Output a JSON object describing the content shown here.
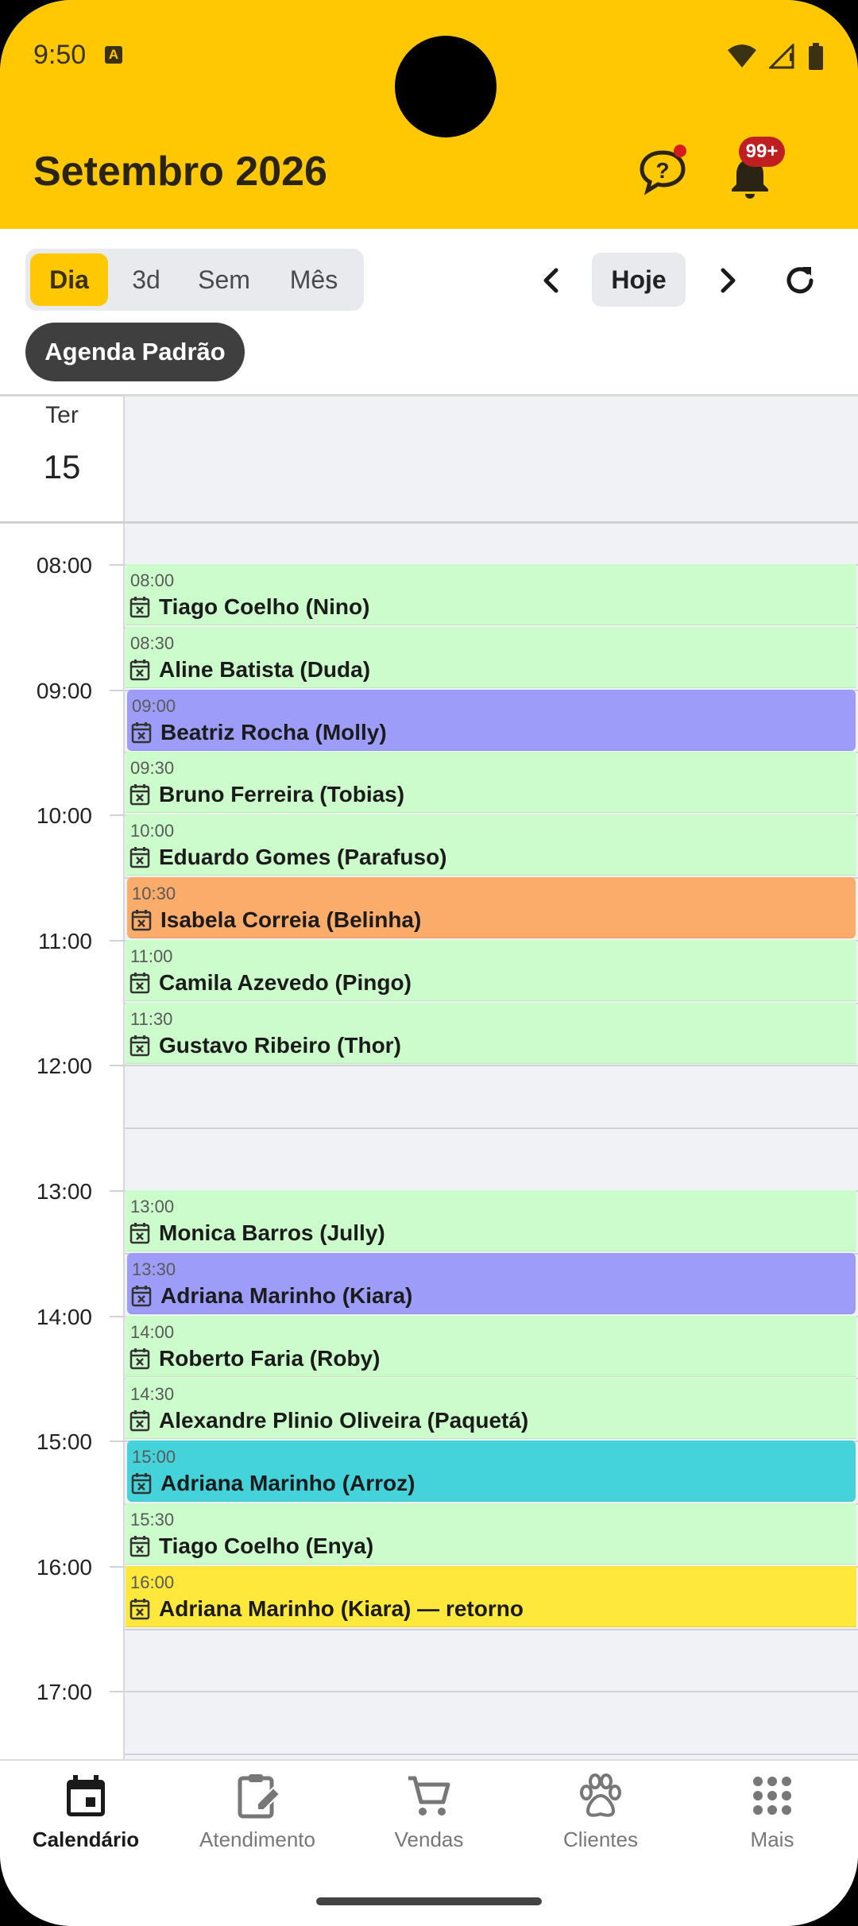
{
  "status": {
    "time": "9:50",
    "badge_letter": "A"
  },
  "header": {
    "title": "Setembro 2026",
    "notifications_badge": "99+"
  },
  "view_modes": [
    {
      "label": "Dia",
      "active": true
    },
    {
      "label": "3d",
      "active": false
    },
    {
      "label": "Sem",
      "active": false
    },
    {
      "label": "Mês",
      "active": false
    }
  ],
  "toolbar": {
    "today_label": "Hoje",
    "agenda_chip": "Agenda Padrão"
  },
  "day": {
    "weekday": "Ter",
    "number": "15"
  },
  "hours": [
    "08:00",
    "09:00",
    "10:00",
    "11:00",
    "12:00",
    "13:00",
    "14:00",
    "15:00",
    "16:00",
    "17:00"
  ],
  "events": [
    {
      "time": "08:00",
      "title": "Tiago Coelho (Nino)",
      "color": "#CCFCCB"
    },
    {
      "time": "08:30",
      "title": "Aline Batista (Duda)",
      "color": "#CCFCCB"
    },
    {
      "time": "09:00",
      "title": "Beatriz Rocha (Molly)",
      "color": "#9D9DF9"
    },
    {
      "time": "09:30",
      "title": "Bruno Ferreira (Tobias)",
      "color": "#CCFCCB"
    },
    {
      "time": "10:00",
      "title": "Eduardo Gomes (Parafuso)",
      "color": "#CCFCCB"
    },
    {
      "time": "10:30",
      "title": "Isabela Correia (Belinha)",
      "color": "#FBAB6A"
    },
    {
      "time": "11:00",
      "title": "Camila Azevedo (Pingo)",
      "color": "#CCFCCB"
    },
    {
      "time": "11:30",
      "title": "Gustavo Ribeiro (Thor)",
      "color": "#CCFCCB"
    },
    {
      "time": "13:00",
      "title": "Monica Barros (Jully)",
      "color": "#CCFCCB"
    },
    {
      "time": "13:30",
      "title": "Adriana Marinho (Kiara)",
      "color": "#9D9DF9"
    },
    {
      "time": "14:00",
      "title": "Roberto Faria (Roby)",
      "color": "#CCFCCB"
    },
    {
      "time": "14:30",
      "title": "Alexandre Plinio Oliveira (Paquetá)",
      "color": "#CCFCCB"
    },
    {
      "time": "15:00",
      "title": "Adriana Marinho (Arroz)",
      "color": "#44D3DB"
    },
    {
      "time": "15:30",
      "title": "Tiago Coelho (Enya)",
      "color": "#CCFCCB"
    },
    {
      "time": "16:00",
      "title": "Adriana Marinho (Kiara) — retorno",
      "color": "#FDE83B"
    }
  ],
  "bottom_nav": [
    {
      "label": "Calendário",
      "icon": "calendar-icon",
      "active": true
    },
    {
      "label": "Atendimento",
      "icon": "clipboard-edit-icon",
      "active": false
    },
    {
      "label": "Vendas",
      "icon": "cart-icon",
      "active": false
    },
    {
      "label": "Clientes",
      "icon": "paw-icon",
      "active": false
    },
    {
      "label": "Mais",
      "icon": "grid-dots-icon",
      "active": false
    }
  ]
}
